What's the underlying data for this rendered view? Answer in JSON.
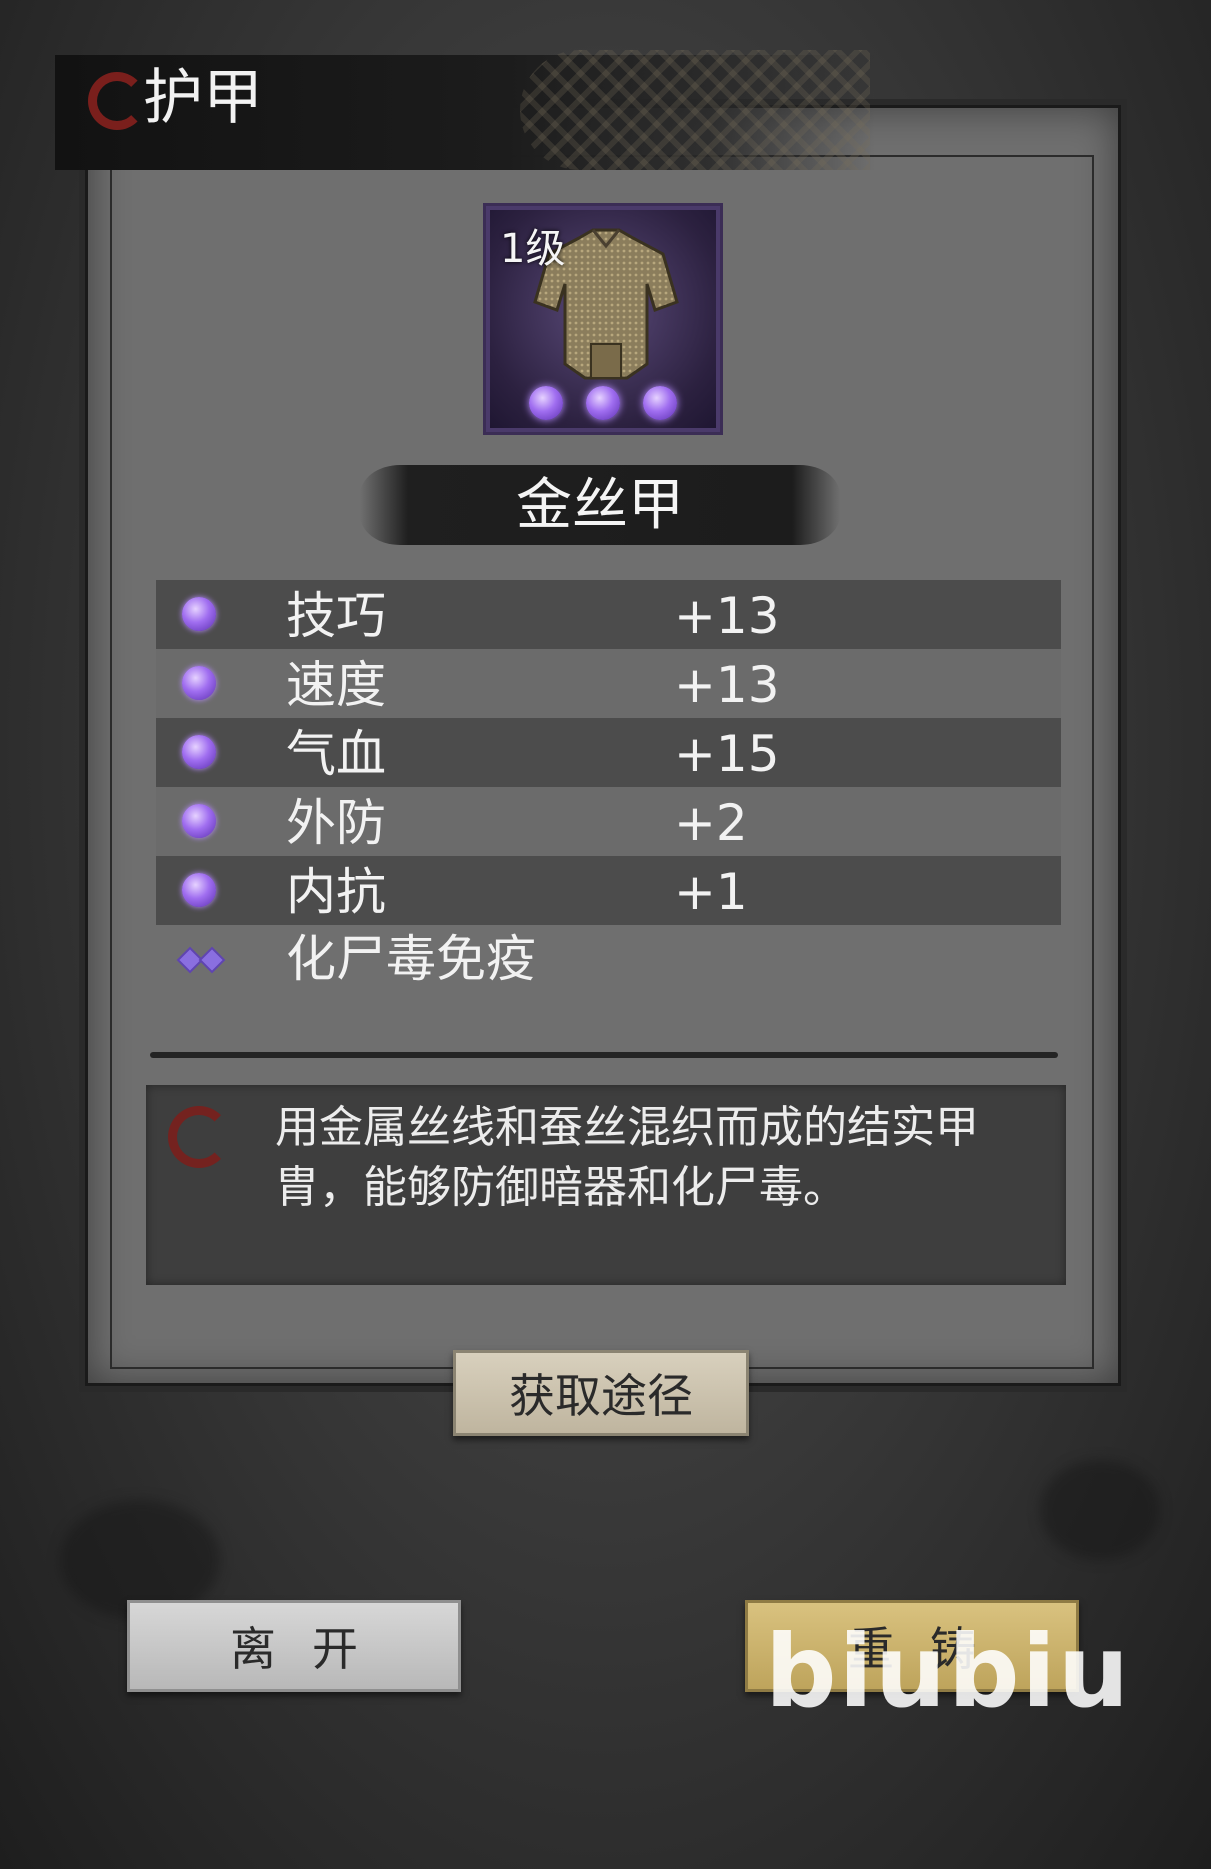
{
  "header": {
    "title": "护甲"
  },
  "item": {
    "level": "1级",
    "name": "金丝甲",
    "star_count": 3
  },
  "stats": [
    {
      "name": "技巧",
      "value": "+13"
    },
    {
      "name": "速度",
      "value": "+13"
    },
    {
      "name": "气血",
      "value": "+15"
    },
    {
      "name": "外防",
      "value": "+2"
    },
    {
      "name": "内抗",
      "value": "+1"
    }
  ],
  "special_effect": "化尸毒免疫",
  "description": "用金属丝线和蚕丝混织而成的结实甲胄，能够防御暗器和化尸毒。",
  "buttons": {
    "source": "获取途径",
    "leave": "离开",
    "reforge": "重铸"
  },
  "watermark": "biubiu",
  "colors": {
    "accent_purple": "#a06ef0",
    "logo_red": "#7a1f1c",
    "reforge_gold": "#d9c27f"
  }
}
